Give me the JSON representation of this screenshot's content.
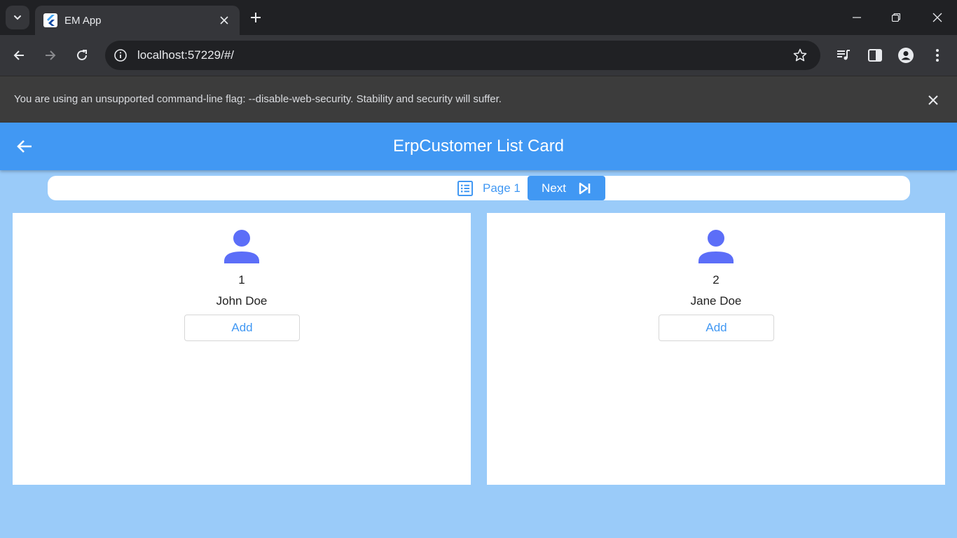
{
  "browser": {
    "tab_title": "EM App",
    "url": "localhost:57229/#/",
    "infobar_text": "You are using an unsupported command-line flag: --disable-web-security. Stability and security will suffer."
  },
  "app": {
    "title": "ErpCustomer List Card",
    "pager": {
      "page_label": "Page 1",
      "next_label": "Next"
    },
    "customers": [
      {
        "id": "1",
        "name": "John Doe",
        "add_label": "Add"
      },
      {
        "id": "2",
        "name": "Jane Doe",
        "add_label": "Add"
      }
    ]
  },
  "colors": {
    "app_bar": "#4198f3",
    "app_background": "#9acbf9",
    "avatar": "#5c6ef8",
    "browser_frame": "#202124"
  }
}
